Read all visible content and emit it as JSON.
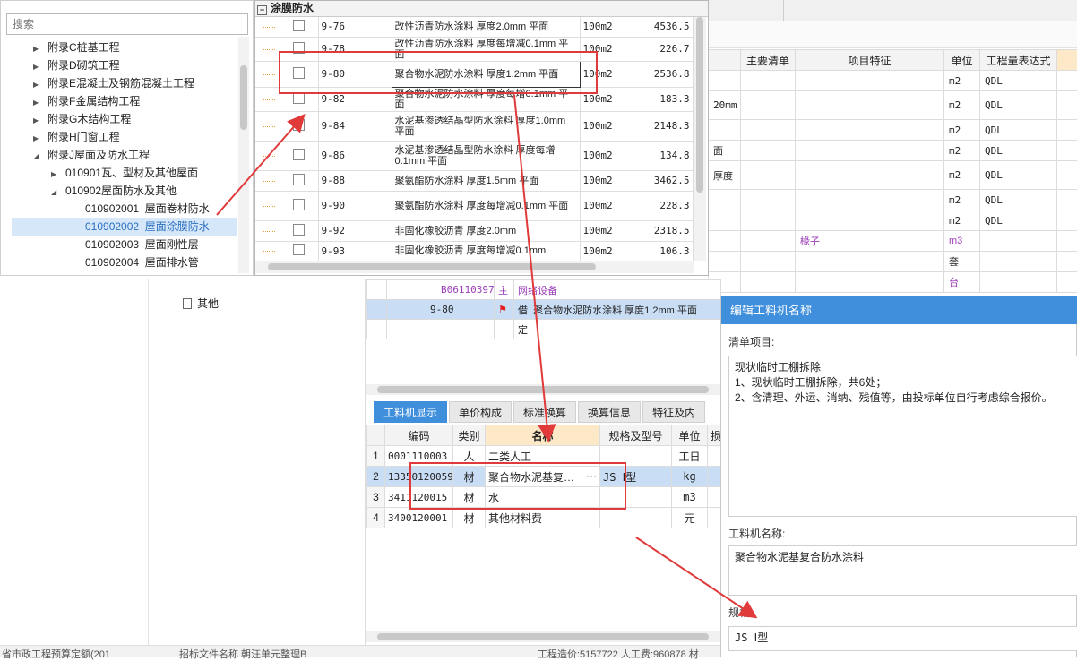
{
  "tree": {
    "search_placeholder": "搜索",
    "items": [
      {
        "label": "附录C桩基工程"
      },
      {
        "label": "附录D砌筑工程"
      },
      {
        "label": "附录E混凝土及钢筋混凝土工程"
      },
      {
        "label": "附录F金属结构工程"
      },
      {
        "label": "附录G木结构工程"
      },
      {
        "label": "附录H门窗工程"
      },
      {
        "label": "附录J屋面及防水工程"
      },
      {
        "label": "010901瓦、型材及其他屋面"
      },
      {
        "label": "010902屋面防水及其他"
      },
      {
        "code": "010902001",
        "name": "屋面卷材防水"
      },
      {
        "code": "010902002",
        "name": "屋面涂膜防水"
      },
      {
        "code": "010902003",
        "name": "屋面刚性层"
      },
      {
        "code": "010902004",
        "name": "屋面排水管"
      }
    ]
  },
  "quota": {
    "group_title": "涂膜防水",
    "rows": [
      {
        "code": "9-76",
        "name": "改性沥青防水涂料 厚度2.0mm 平面",
        "unit": "100m2",
        "price": "4536.5"
      },
      {
        "code": "9-78",
        "name": "改性沥青防水涂料 厚度每增减0.1mm 平面",
        "unit": "100m2",
        "price": "226.7"
      },
      {
        "code": "9-80",
        "name": "聚合物水泥防水涂料 厚度1.2mm 平面",
        "unit": "100m2",
        "price": "2536.8"
      },
      {
        "code": "9-82",
        "name": "聚合物水泥防水涂料 厚度每增0.1mm 平面",
        "unit": "100m2",
        "price": "183.3"
      },
      {
        "code": "9-84",
        "name": "水泥基渗透结晶型防水涂料 厚度1.0mm 平面",
        "unit": "100m2",
        "price": "2148.3"
      },
      {
        "code": "9-86",
        "name": "水泥基渗透结晶型防水涂料 厚度每增0.1mm 平面",
        "unit": "100m2",
        "price": "134.8"
      },
      {
        "code": "9-88",
        "name": "聚氨酯防水涂料 厚度1.5mm 平面",
        "unit": "100m2",
        "price": "3462.5"
      },
      {
        "code": "9-90",
        "name": "聚氨酯防水涂料 厚度每增减0.1mm 平面",
        "unit": "100m2",
        "price": "228.3"
      },
      {
        "code": "9-92",
        "name": "非固化橡胶沥青 厚度2.0mm",
        "unit": "100m2",
        "price": "2318.5"
      },
      {
        "code": "9-93",
        "name": "非固化橡胶沥青 厚度每增减0.1mm",
        "unit": "100m2",
        "price": "106.3"
      }
    ]
  },
  "bill_table": {
    "headers": [
      "主要清单",
      "项目特征",
      "单位",
      "工程量表达式"
    ],
    "rows": [
      {
        "lead": "",
        "feature": "",
        "unit": "m2",
        "expr": "QDL"
      },
      {
        "lead": "20mm",
        "feature": "",
        "unit": "m2",
        "expr": "QDL"
      },
      {
        "lead": "",
        "feature": "",
        "unit": "m2",
        "expr": "QDL"
      },
      {
        "lead": "面",
        "feature": "",
        "unit": "m2",
        "expr": "QDL"
      },
      {
        "lead": " 厚度",
        "feature": "",
        "unit": "m2",
        "expr": "QDL"
      },
      {
        "lead": "",
        "feature": "",
        "unit": "m2",
        "expr": "QDL"
      },
      {
        "lead": "",
        "feature": "",
        "unit": "m2",
        "expr": "QDL"
      },
      {
        "lead": "",
        "feature": "椽子",
        "unit": "m3",
        "expr": ""
      },
      {
        "lead": "",
        "feature": "",
        "unit": "套",
        "expr": ""
      },
      {
        "lead": "",
        "feature": "",
        "unit": "台",
        "expr": ""
      }
    ]
  },
  "left_lower": {
    "node": "其他"
  },
  "mid_rows": [
    {
      "code": "B06110397",
      "type": "主",
      "name": "网络设备"
    },
    {
      "code": "9-80",
      "type": "借",
      "name": "聚合物水泥防水涂料 厚度1.2mm 平面"
    },
    {
      "code": "",
      "type": "定",
      "name": ""
    }
  ],
  "bottom_tabs": [
    "工料机显示",
    "单价构成",
    "标准换算",
    "换算信息",
    "特征及内"
  ],
  "resources": {
    "headers": [
      "编码",
      "类别",
      "名称",
      "规格及型号",
      "单位",
      "损"
    ],
    "rows": [
      {
        "n": "1",
        "code": "0001110003",
        "cat": "人",
        "name": "二类人工",
        "spec": "",
        "unit": "工日"
      },
      {
        "n": "2",
        "code": "13350120059",
        "cat": "材",
        "name": "聚合物水泥基复…",
        "spec": "JS Ⅰ型",
        "unit": "kg"
      },
      {
        "n": "3",
        "code": "3411120015",
        "cat": "材",
        "name": "水",
        "spec": "",
        "unit": "m3"
      },
      {
        "n": "4",
        "code": "3400120001",
        "cat": "材",
        "name": "其他材料费",
        "spec": "",
        "unit": "元"
      }
    ]
  },
  "dialog": {
    "title": "编辑工料机名称",
    "bill_label": "清单项目:",
    "bill_text": "现状临时工棚拆除\n1、现状临时工棚拆除，共6处；\n2、含清理、外运、消纳、残值等，由投标单位自行考虑综合报价。",
    "name_label": "工料机名称:",
    "name_value": "聚合物水泥基复合防水涂料",
    "spec_label": "规格",
    "spec_value": "JS Ⅰ型"
  },
  "status": {
    "left": "省市政工程预算定额(201",
    "mid": "招标文件名称  朝汪单元整理B",
    "right": "工程造价:5157722  人工费:960878  材"
  },
  "colors": {
    "accent": "#3f8fdc",
    "annotation": "#e03a3a",
    "selected_row": "#c9def5"
  }
}
